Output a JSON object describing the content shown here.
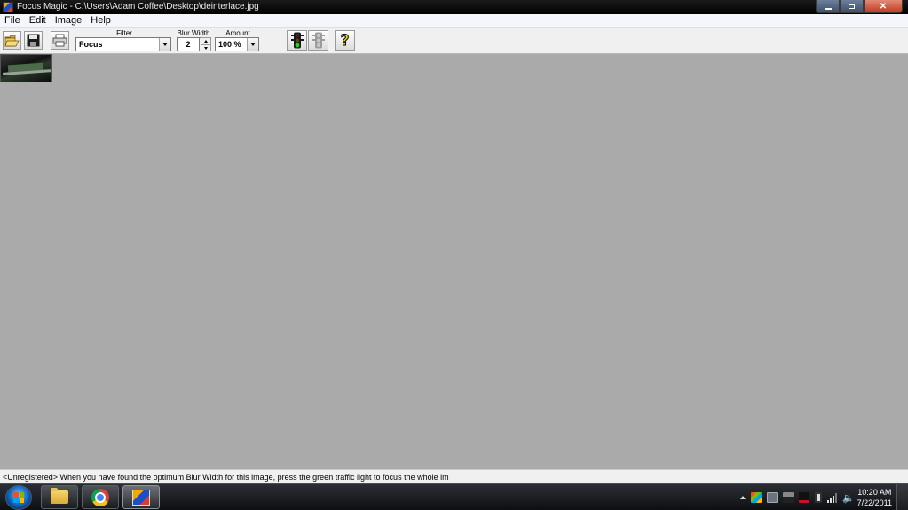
{
  "window": {
    "title": "Focus Magic - C:\\Users\\Adam Coffee\\Desktop\\deinterlace.jpg"
  },
  "menu": [
    "File",
    "Edit",
    "Image",
    "Help"
  ],
  "toolbar": {
    "filter_label": "Filter",
    "filter_value": "Focus",
    "blur_width_label": "Blur Width",
    "blur_width_value": "2",
    "amount_label": "Amount",
    "amount_value": "100 %",
    "help_label": "?"
  },
  "status": {
    "text": "<Unregistered>  When you have found the optimum Blur Width for this image, press the green traffic light to focus the whole im"
  },
  "taskbar": {
    "time": "10:20 AM",
    "date": "7/22/2011"
  },
  "colors": {
    "workspace": "#aaaaaa",
    "close_button": "#c1391f",
    "traffic_light_green": "#1fa31f"
  }
}
